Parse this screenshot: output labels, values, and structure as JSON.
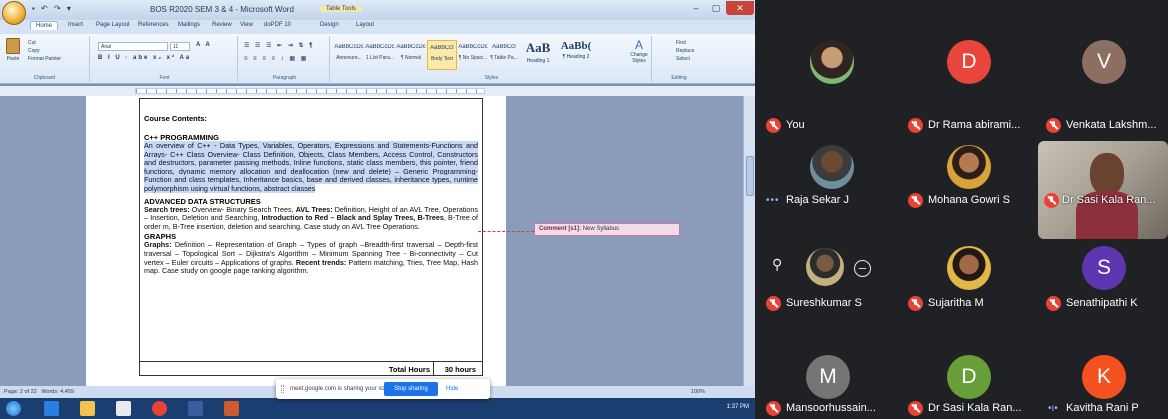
{
  "word": {
    "title": "BOS R2020 SEM 3 & 4 - Microsoft Word",
    "context_tab": "Table Tools",
    "quick_access": "▪ ↶ ↷ ▾",
    "window_controls": {
      "minimize": "–",
      "maximize": "▢",
      "close": "✕"
    },
    "ribbon_tabs": [
      "Home",
      "Insert",
      "Page Layout",
      "References",
      "Mailings",
      "Review",
      "View",
      "doPDF 10",
      "Design",
      "Layout"
    ],
    "clipboard": {
      "paste": "Paste",
      "cut": "Cut",
      "copy": "Copy",
      "format_painter": "Format Painter",
      "label": "Clipboard"
    },
    "font": {
      "name": "Arial",
      "size": "11",
      "label": "Font",
      "format_row": "B I U · abe x₂ x² Aa",
      "grow_row": "A A"
    },
    "paragraph": {
      "label": "Paragraph",
      "list_row": "☰ ☰ ☰ ⇤ ⇥ ⇅ ¶",
      "align_row": "≡ ≡ ≡ ≡ ↕ ▦ ▦"
    },
    "styles": {
      "label": "Styles",
      "items": [
        {
          "sample": "AaBbCcDc",
          "name": "Annexure..."
        },
        {
          "sample": "AaBbCcDc",
          "name": "1 List Para..."
        },
        {
          "sample": "AaBbCcDc",
          "name": "¶ Normal"
        },
        {
          "sample": "AaBbCcI",
          "name": "Body Text"
        },
        {
          "sample": "AaBbCcDc",
          "name": "¶ No Spaci..."
        },
        {
          "sample": "AaBbCcI",
          "name": "¶ Table Pa..."
        },
        {
          "sample": "AaB",
          "name": "Heading 1"
        },
        {
          "sample": "AaBb(",
          "name": "¶ Heading 2"
        }
      ],
      "change_styles": "Change Styles"
    },
    "editing": {
      "label": "Editing",
      "find": "Find",
      "replace": "Replace",
      "select": "Select"
    },
    "document": {
      "course_contents": "Course Contents:",
      "sections": [
        {
          "heading": "C++ PROGRAMMING",
          "body": "An overview of C++ - Data Types, Variables, Operators, Expressions and Statements-Functions and Arrays- C++ Class Overview- Class Definition, Objects, Class Members, Access Control, Constructors and destructors, parameter passing methods, Inline functions, static class members, this pointer, friend functions, dynamic memory allocation and deallocation (new and delete) – Generic Programming- Function and class templates, Inheritance basics, base and derived classes, inheritance types, runtime polymorphism using virtual functions, abstract classes"
        },
        {
          "heading": "ADVANCED DATA STRUCTURES",
          "body_parts": [
            {
              "t": "Search trees:",
              "b": true
            },
            {
              "t": " Overview- Binary Search Trees, ",
              "b": false
            },
            {
              "t": "AVL Trees:",
              "b": true
            },
            {
              "t": " Definition, Height of an AVL Tree, Operations – Insertion, Deletion and Searching, ",
              "b": false
            },
            {
              "t": "Introduction to Red – Black and Splay Trees, B-Trees",
              "b": true
            },
            {
              "t": ", B-Tree of order m, B-Tree insertion, deletion and searching. Case study on AVL Tree Operations.",
              "b": false
            }
          ]
        },
        {
          "heading": "GRAPHS",
          "body_parts": [
            {
              "t": "Graphs:",
              "b": true
            },
            {
              "t": " Definition – Representation of Graph – Types of graph –Breadth-first traversal – Depth-first traversal – Topological Sort – Dijkstra's Algorithm – Minimum Spanning Tree - Bi-connectivity – Cut vertex – Euler circuits – Applications of graphs. ",
              "b": false
            },
            {
              "t": "Recent trends:",
              "b": true
            },
            {
              "t": " Pattern matching, Tries, Tree Map, Hash map. Case study on google page ranking algorithm.",
              "b": false
            }
          ]
        }
      ],
      "total_hours_label": "Total Hours",
      "total_hours_value": "30 hours"
    },
    "comment": {
      "label": "Comment [s1]:",
      "text": "New Syllabus"
    },
    "status": {
      "page": "Page: 2 of 22",
      "words": "Words: 4,459",
      "zoom": "100%"
    },
    "taskbar_time": "1:37 PM"
  },
  "share_bar": {
    "text": "meet.google.com is sharing your screen.",
    "stop": "Stop sharing",
    "hide": "Hide"
  },
  "participants": [
    {
      "name": "You",
      "type": "photo",
      "mic_off": true
    },
    {
      "name": "Dr Rama abirami...",
      "type": "letter",
      "letter": "D",
      "color": "#e8453c",
      "mic_off": true
    },
    {
      "name": "Venkata Lakshm...",
      "type": "letter",
      "letter": "V",
      "color": "#8d6e63",
      "mic_off": true
    },
    {
      "name": "Raja Sekar J",
      "type": "photo",
      "mic_off": false
    },
    {
      "name": "Mohana Gowri S",
      "type": "photo",
      "mic_off": true
    },
    {
      "name": "Dr Sasi Kala Ran...",
      "type": "video",
      "mic_off": true
    },
    {
      "name": "Sureshkumar S",
      "type": "photo",
      "mic_off": true
    },
    {
      "name": "Sujaritha M",
      "type": "photo",
      "mic_off": true
    },
    {
      "name": "Senathipathi K",
      "type": "letter",
      "letter": "S",
      "color": "#5e35b1",
      "mic_off": true
    },
    {
      "name": "Mansoorhussain...",
      "type": "letter",
      "letter": "M",
      "color": "#757575",
      "mic_off": true
    },
    {
      "name": "Dr Sasi Kala Ran...",
      "type": "letter",
      "letter": "D",
      "color": "#689f38",
      "mic_off": true
    },
    {
      "name": "Kavitha Rani P",
      "type": "letter",
      "letter": "K",
      "color": "#f4511e",
      "mic_off": false
    }
  ],
  "icons": {
    "more": "•••",
    "speaking": "•ı•",
    "pin": "⚲",
    "remove": "–"
  }
}
